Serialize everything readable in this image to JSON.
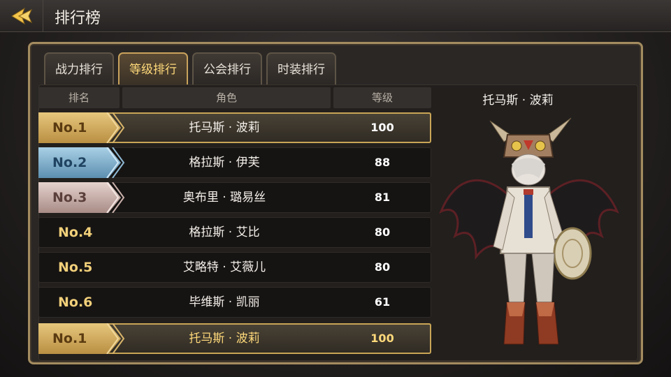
{
  "header": {
    "title": "排行榜"
  },
  "tabs": [
    {
      "label": "战力排行",
      "active": false
    },
    {
      "label": "等级排行",
      "active": true
    },
    {
      "label": "公会排行",
      "active": false
    },
    {
      "label": "时装排行",
      "active": false
    }
  ],
  "table": {
    "columns": [
      "排名",
      "角色",
      "等级"
    ],
    "rows": [
      {
        "rank": "No.1",
        "name": "托马斯 · 波莉",
        "level": "100",
        "medal": "gold"
      },
      {
        "rank": "No.2",
        "name": "格拉斯 · 伊芙",
        "level": "88",
        "medal": "silver"
      },
      {
        "rank": "No.3",
        "name": "奥布里 · 璐易丝",
        "level": "81",
        "medal": "bronze"
      },
      {
        "rank": "No.4",
        "name": "格拉斯 · 艾比",
        "level": "80",
        "medal": "none"
      },
      {
        "rank": "No.5",
        "name": "艾略特 · 艾薇儿",
        "level": "80",
        "medal": "none"
      },
      {
        "rank": "No.6",
        "name": "毕维斯 · 凯丽",
        "level": "61",
        "medal": "none"
      }
    ],
    "self_row": {
      "rank": "No.1",
      "name": "托马斯 · 波莉",
      "level": "100",
      "medal": "gold"
    }
  },
  "preview": {
    "character_name": "托马斯 · 波莉",
    "figure_icon": "character-model"
  },
  "colors": {
    "gold": "#c9a556",
    "accent_text": "#ffd97a",
    "silver": "#5c8fb0",
    "bronze": "#a88c86"
  }
}
